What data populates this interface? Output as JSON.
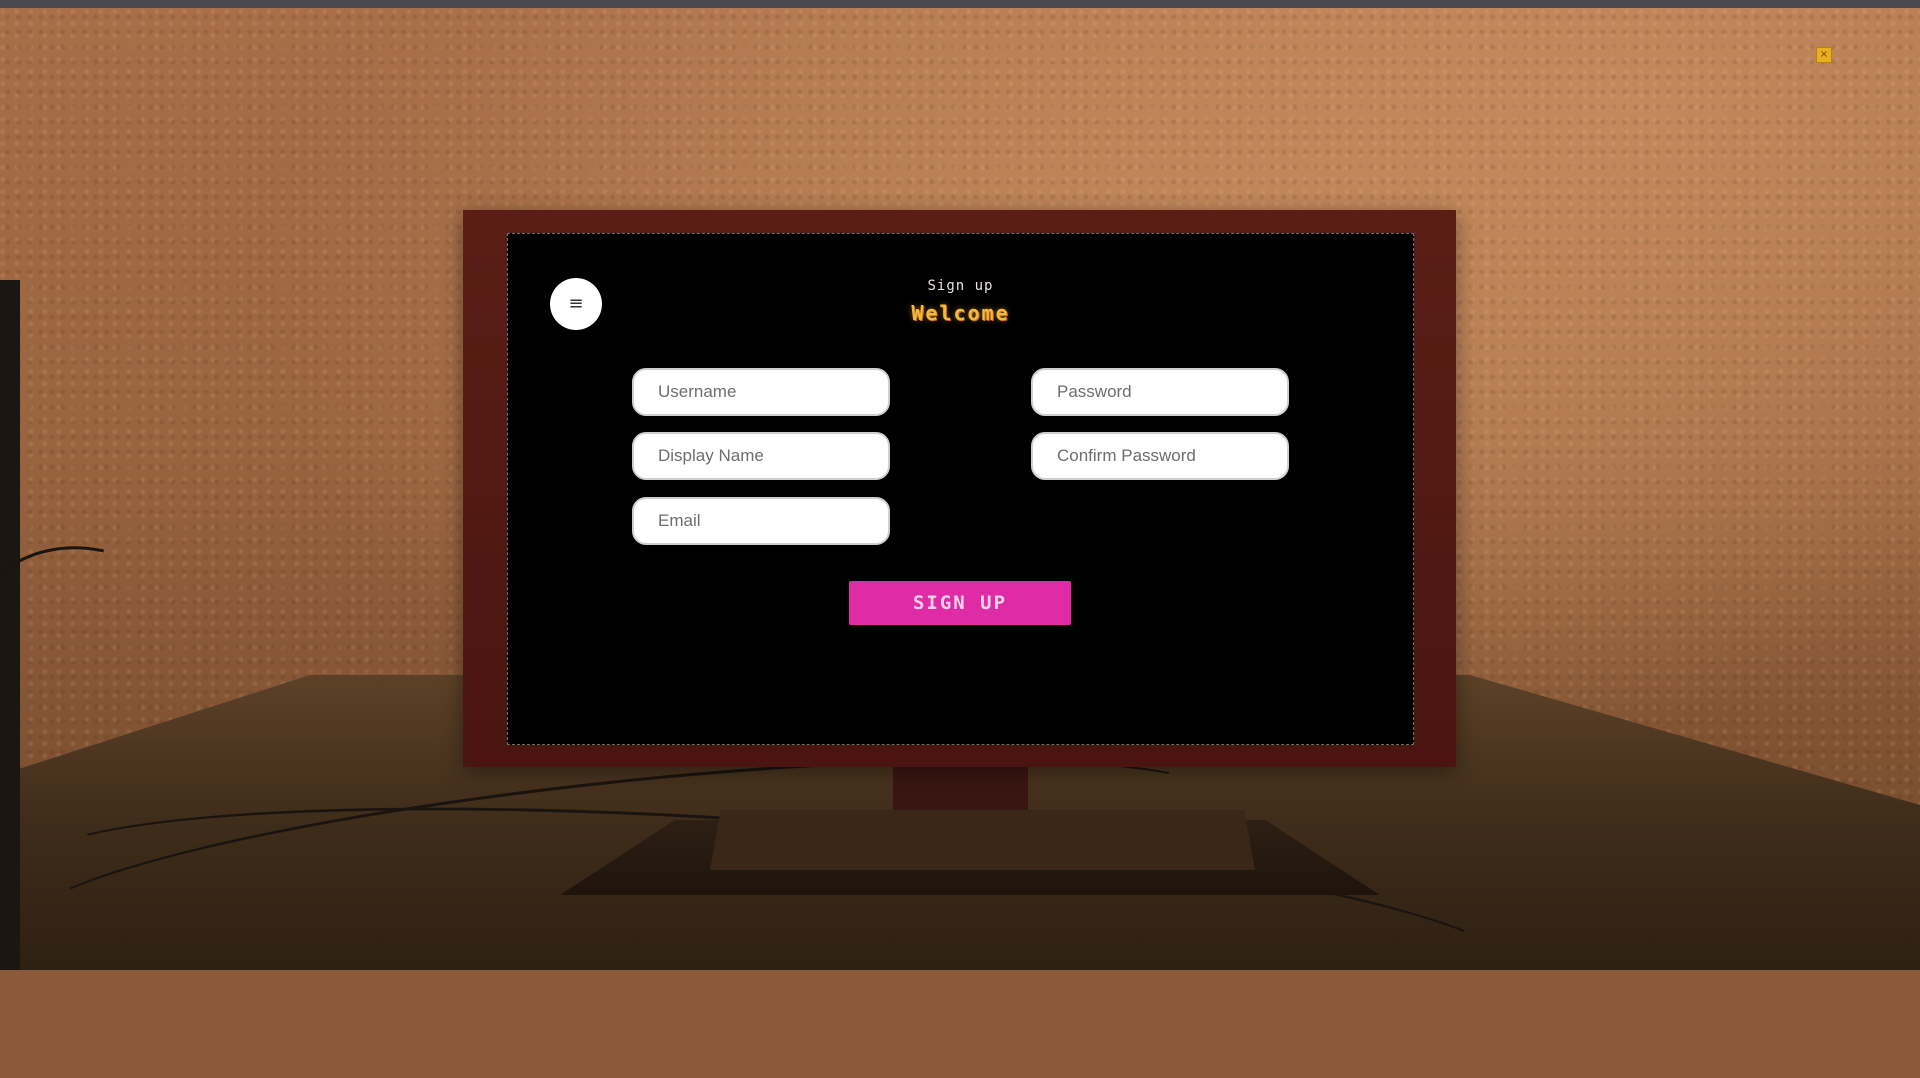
{
  "form": {
    "subtitle": "Sign up",
    "title": "Welcome",
    "menu_icon": "≡",
    "fields": {
      "username": {
        "placeholder": "Username",
        "value": ""
      },
      "password": {
        "placeholder": "Password",
        "value": ""
      },
      "display_name": {
        "placeholder": "Display Name",
        "value": ""
      },
      "confirm_password": {
        "placeholder": "Confirm Password",
        "value": ""
      },
      "email": {
        "placeholder": "Email",
        "value": ""
      }
    },
    "submit_label": "SIGN UP"
  },
  "overlay": {
    "close_icon": "×"
  },
  "colors": {
    "accent": "#e02ba6",
    "title": "#f2b93a",
    "screen_bg": "#000000",
    "bezel": "#4a1510"
  },
  "icons": {
    "menu": "hamburger-menu-icon",
    "close": "close-icon"
  }
}
